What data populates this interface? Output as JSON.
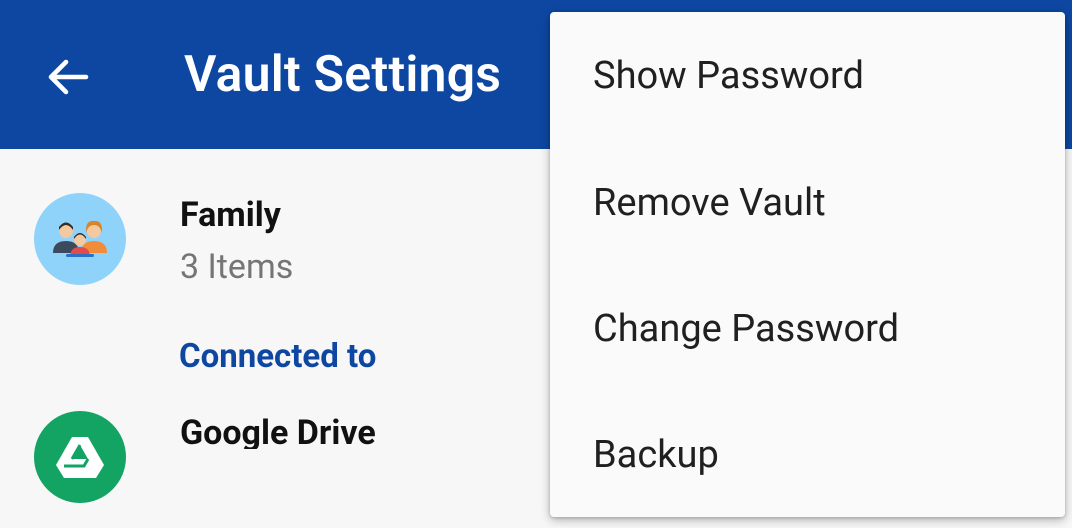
{
  "appbar": {
    "title": "Vault Settings",
    "back_icon": "arrow-left-icon",
    "background": "#0d47a1"
  },
  "vault": {
    "name": "Family",
    "item_count": "3 Items",
    "icon": "family-icon"
  },
  "connection": {
    "section_label": "Connected to",
    "service_name": "Google Drive",
    "service_icon": "google-drive-icon"
  },
  "menu": {
    "items": [
      {
        "label": "Show Password"
      },
      {
        "label": "Remove Vault"
      },
      {
        "label": "Change Password"
      },
      {
        "label": "Backup"
      }
    ]
  }
}
